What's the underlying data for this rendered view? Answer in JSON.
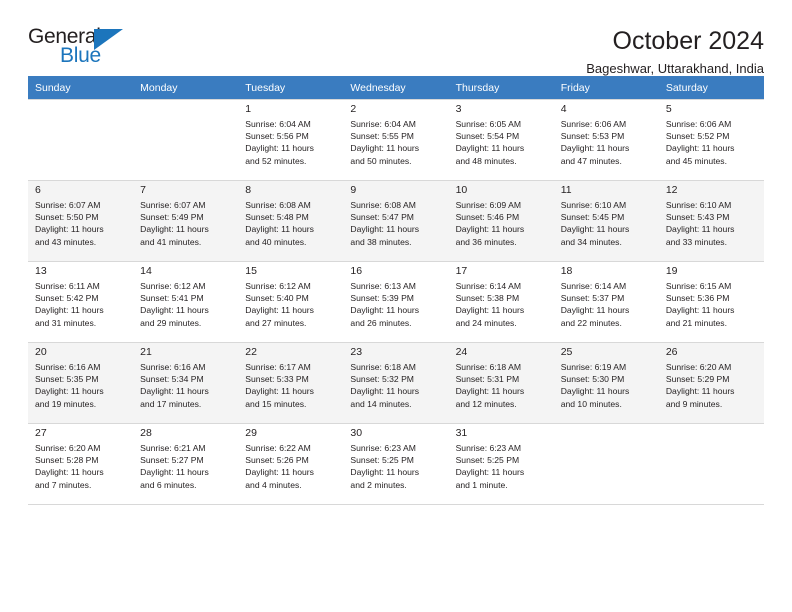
{
  "brand": {
    "name_part1": "General",
    "name_part2": "Blue",
    "accent_color": "#1c75bc"
  },
  "header": {
    "title": "October 2024",
    "subtitle": "Bageshwar, Uttarakhand, India"
  },
  "theme": {
    "header_row_bg": "#3a7cc0",
    "shaded_row_bg": "#f4f4f4",
    "text_color": "#231f20",
    "border_color": "#d8d8d8"
  },
  "columns": [
    "Sunday",
    "Monday",
    "Tuesday",
    "Wednesday",
    "Thursday",
    "Friday",
    "Saturday"
  ],
  "labels": {
    "sunrise_prefix": "Sunrise:",
    "sunset_prefix": "Sunset:",
    "daylight_prefix": "Daylight:"
  },
  "weeks": [
    {
      "shaded": false,
      "days": [
        {
          "empty": true
        },
        {
          "empty": true
        },
        {
          "day": "1",
          "line1": "Sunrise: 6:04 AM",
          "line2": "Sunset: 5:56 PM",
          "line3": "Daylight: 11 hours",
          "line4": "and 52 minutes."
        },
        {
          "day": "2",
          "line1": "Sunrise: 6:04 AM",
          "line2": "Sunset: 5:55 PM",
          "line3": "Daylight: 11 hours",
          "line4": "and 50 minutes."
        },
        {
          "day": "3",
          "line1": "Sunrise: 6:05 AM",
          "line2": "Sunset: 5:54 PM",
          "line3": "Daylight: 11 hours",
          "line4": "and 48 minutes."
        },
        {
          "day": "4",
          "line1": "Sunrise: 6:06 AM",
          "line2": "Sunset: 5:53 PM",
          "line3": "Daylight: 11 hours",
          "line4": "and 47 minutes."
        },
        {
          "day": "5",
          "line1": "Sunrise: 6:06 AM",
          "line2": "Sunset: 5:52 PM",
          "line3": "Daylight: 11 hours",
          "line4": "and 45 minutes."
        }
      ]
    },
    {
      "shaded": true,
      "days": [
        {
          "day": "6",
          "line1": "Sunrise: 6:07 AM",
          "line2": "Sunset: 5:50 PM",
          "line3": "Daylight: 11 hours",
          "line4": "and 43 minutes."
        },
        {
          "day": "7",
          "line1": "Sunrise: 6:07 AM",
          "line2": "Sunset: 5:49 PM",
          "line3": "Daylight: 11 hours",
          "line4": "and 41 minutes."
        },
        {
          "day": "8",
          "line1": "Sunrise: 6:08 AM",
          "line2": "Sunset: 5:48 PM",
          "line3": "Daylight: 11 hours",
          "line4": "and 40 minutes."
        },
        {
          "day": "9",
          "line1": "Sunrise: 6:08 AM",
          "line2": "Sunset: 5:47 PM",
          "line3": "Daylight: 11 hours",
          "line4": "and 38 minutes."
        },
        {
          "day": "10",
          "line1": "Sunrise: 6:09 AM",
          "line2": "Sunset: 5:46 PM",
          "line3": "Daylight: 11 hours",
          "line4": "and 36 minutes."
        },
        {
          "day": "11",
          "line1": "Sunrise: 6:10 AM",
          "line2": "Sunset: 5:45 PM",
          "line3": "Daylight: 11 hours",
          "line4": "and 34 minutes."
        },
        {
          "day": "12",
          "line1": "Sunrise: 6:10 AM",
          "line2": "Sunset: 5:43 PM",
          "line3": "Daylight: 11 hours",
          "line4": "and 33 minutes."
        }
      ]
    },
    {
      "shaded": false,
      "days": [
        {
          "day": "13",
          "line1": "Sunrise: 6:11 AM",
          "line2": "Sunset: 5:42 PM",
          "line3": "Daylight: 11 hours",
          "line4": "and 31 minutes."
        },
        {
          "day": "14",
          "line1": "Sunrise: 6:12 AM",
          "line2": "Sunset: 5:41 PM",
          "line3": "Daylight: 11 hours",
          "line4": "and 29 minutes."
        },
        {
          "day": "15",
          "line1": "Sunrise: 6:12 AM",
          "line2": "Sunset: 5:40 PM",
          "line3": "Daylight: 11 hours",
          "line4": "and 27 minutes."
        },
        {
          "day": "16",
          "line1": "Sunrise: 6:13 AM",
          "line2": "Sunset: 5:39 PM",
          "line3": "Daylight: 11 hours",
          "line4": "and 26 minutes."
        },
        {
          "day": "17",
          "line1": "Sunrise: 6:14 AM",
          "line2": "Sunset: 5:38 PM",
          "line3": "Daylight: 11 hours",
          "line4": "and 24 minutes."
        },
        {
          "day": "18",
          "line1": "Sunrise: 6:14 AM",
          "line2": "Sunset: 5:37 PM",
          "line3": "Daylight: 11 hours",
          "line4": "and 22 minutes."
        },
        {
          "day": "19",
          "line1": "Sunrise: 6:15 AM",
          "line2": "Sunset: 5:36 PM",
          "line3": "Daylight: 11 hours",
          "line4": "and 21 minutes."
        }
      ]
    },
    {
      "shaded": true,
      "days": [
        {
          "day": "20",
          "line1": "Sunrise: 6:16 AM",
          "line2": "Sunset: 5:35 PM",
          "line3": "Daylight: 11 hours",
          "line4": "and 19 minutes."
        },
        {
          "day": "21",
          "line1": "Sunrise: 6:16 AM",
          "line2": "Sunset: 5:34 PM",
          "line3": "Daylight: 11 hours",
          "line4": "and 17 minutes."
        },
        {
          "day": "22",
          "line1": "Sunrise: 6:17 AM",
          "line2": "Sunset: 5:33 PM",
          "line3": "Daylight: 11 hours",
          "line4": "and 15 minutes."
        },
        {
          "day": "23",
          "line1": "Sunrise: 6:18 AM",
          "line2": "Sunset: 5:32 PM",
          "line3": "Daylight: 11 hours",
          "line4": "and 14 minutes."
        },
        {
          "day": "24",
          "line1": "Sunrise: 6:18 AM",
          "line2": "Sunset: 5:31 PM",
          "line3": "Daylight: 11 hours",
          "line4": "and 12 minutes."
        },
        {
          "day": "25",
          "line1": "Sunrise: 6:19 AM",
          "line2": "Sunset: 5:30 PM",
          "line3": "Daylight: 11 hours",
          "line4": "and 10 minutes."
        },
        {
          "day": "26",
          "line1": "Sunrise: 6:20 AM",
          "line2": "Sunset: 5:29 PM",
          "line3": "Daylight: 11 hours",
          "line4": "and 9 minutes."
        }
      ]
    },
    {
      "shaded": false,
      "days": [
        {
          "day": "27",
          "line1": "Sunrise: 6:20 AM",
          "line2": "Sunset: 5:28 PM",
          "line3": "Daylight: 11 hours",
          "line4": "and 7 minutes."
        },
        {
          "day": "28",
          "line1": "Sunrise: 6:21 AM",
          "line2": "Sunset: 5:27 PM",
          "line3": "Daylight: 11 hours",
          "line4": "and 6 minutes."
        },
        {
          "day": "29",
          "line1": "Sunrise: 6:22 AM",
          "line2": "Sunset: 5:26 PM",
          "line3": "Daylight: 11 hours",
          "line4": "and 4 minutes."
        },
        {
          "day": "30",
          "line1": "Sunrise: 6:23 AM",
          "line2": "Sunset: 5:25 PM",
          "line3": "Daylight: 11 hours",
          "line4": "and 2 minutes."
        },
        {
          "day": "31",
          "line1": "Sunrise: 6:23 AM",
          "line2": "Sunset: 5:25 PM",
          "line3": "Daylight: 11 hours",
          "line4": "and 1 minute."
        },
        {
          "empty": true
        },
        {
          "empty": true
        }
      ]
    }
  ]
}
